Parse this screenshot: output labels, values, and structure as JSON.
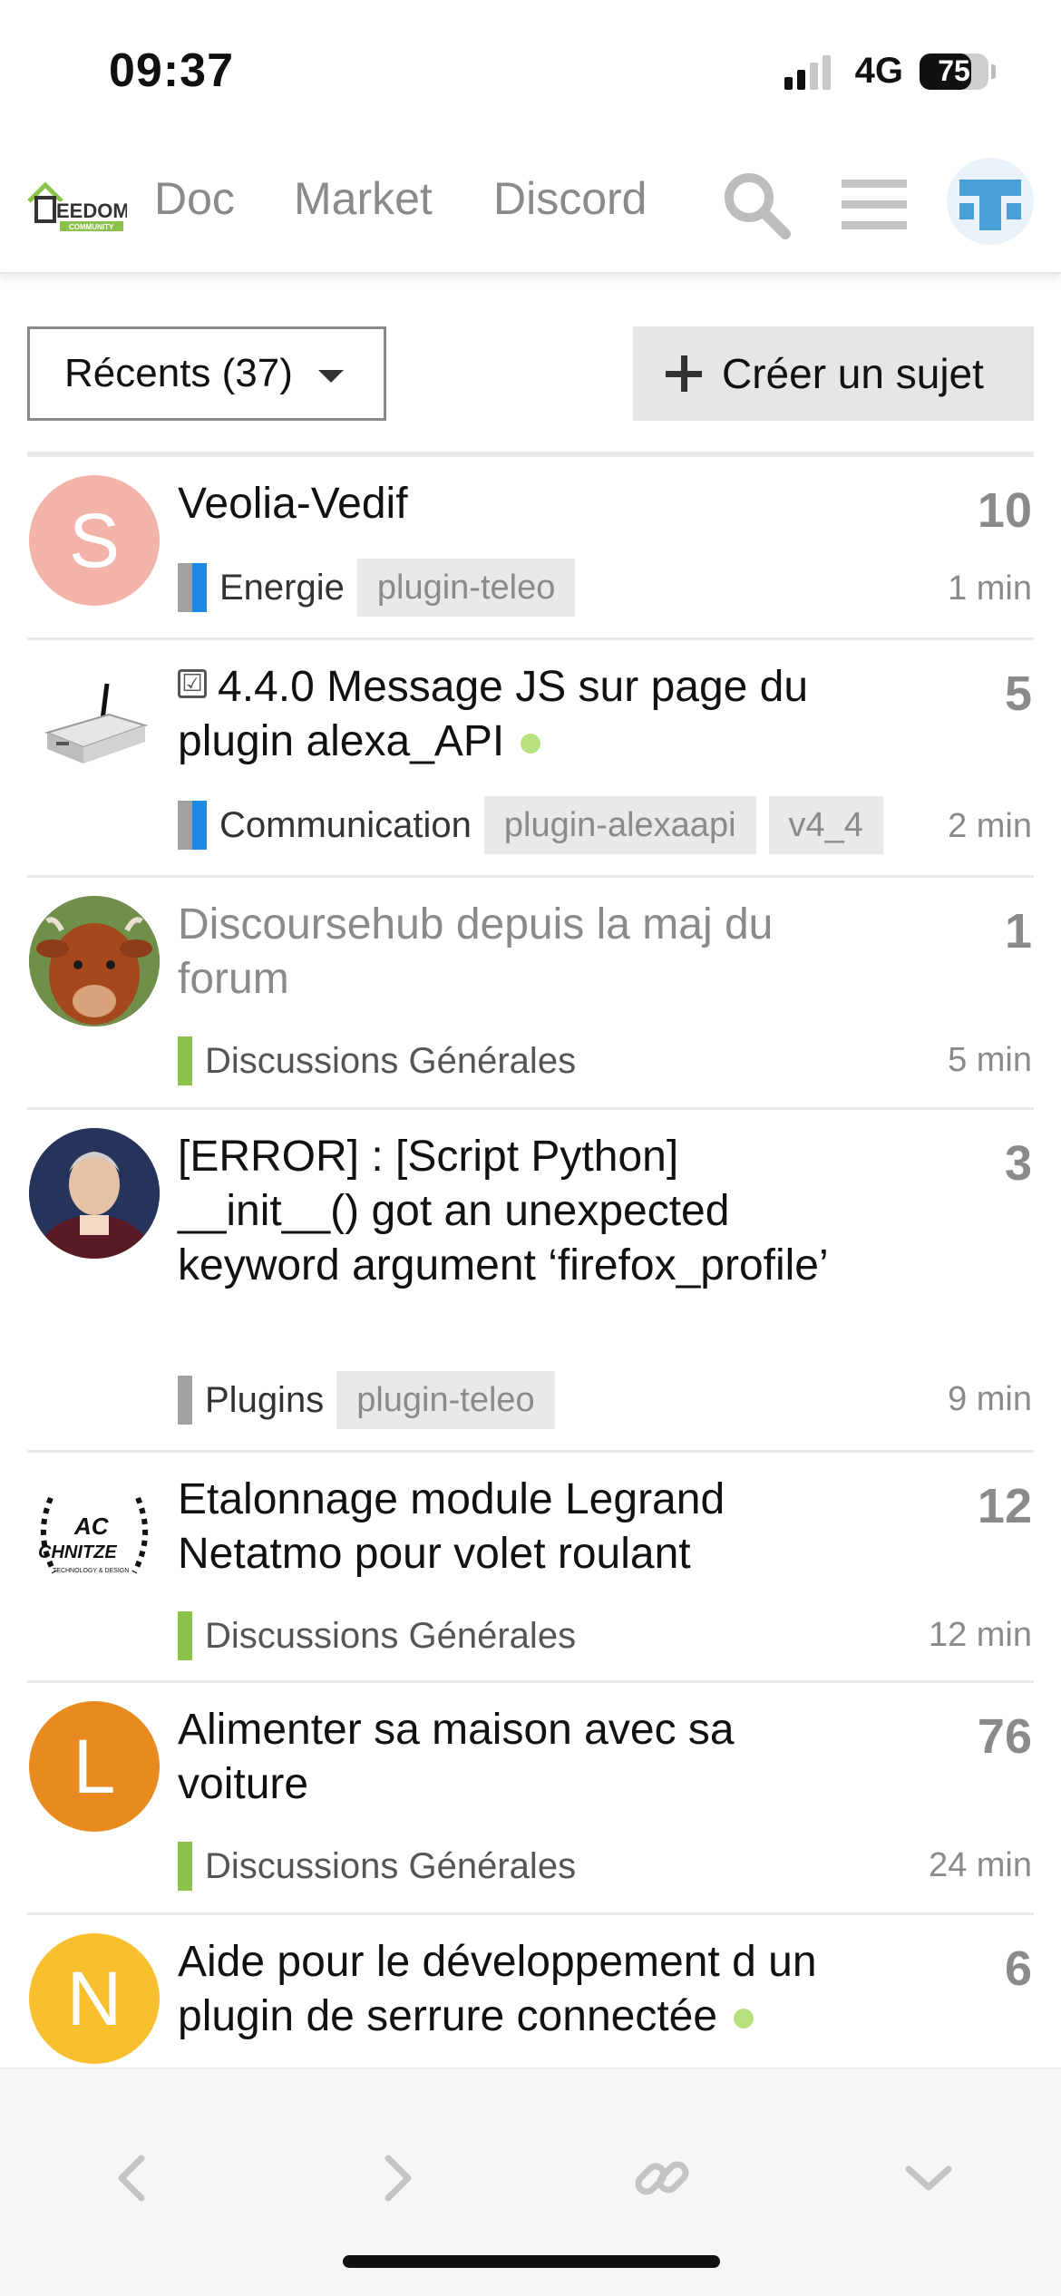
{
  "status_bar": {
    "time": "09:37",
    "network": "4G",
    "battery": "75",
    "battery_level": 0.75
  },
  "header": {
    "logo_name": "jeedom-community-logo",
    "logo_text": "EEDOM",
    "logo_subtext": "COMMUNITY",
    "nav": [
      {
        "label": "Doc"
      },
      {
        "label": "Market"
      },
      {
        "label": "Discord"
      }
    ],
    "icons": [
      "search-icon",
      "hamburger-menu-icon",
      "user-avatar"
    ]
  },
  "toolbar": {
    "filter_label": "Récents (37)",
    "create_label": "Créer un sujet"
  },
  "colors": {
    "accent_green": "#8bc34a",
    "energie_blue": "#1e88e5",
    "gray_text": "#8a8a8a",
    "new_dot": "#b7e27e",
    "avatar_s": "#f2b3aa",
    "avatar_l": "#e88a1f",
    "avatar_n": "#f8c02f"
  },
  "topics": [
    {
      "title": "Veolia-Vedif",
      "avatar_letter": "S",
      "category": "Energie",
      "tags": [
        "plugin-teleo"
      ],
      "replies": "10",
      "age": "1 min"
    },
    {
      "title": "4.4.0 Message JS sur page du plugin alexa_API",
      "solved_icon": "☑",
      "category": "Communication",
      "tags": [
        "plugin-alexaapi",
        "v4_4"
      ],
      "replies": "5",
      "age": "2 min"
    },
    {
      "title": "Discoursehub depuis la maj du forum",
      "category": "Discussions Générales",
      "tags": [],
      "replies": "1",
      "age": "5 min"
    },
    {
      "title": "[ERROR] : [Script Python] __init__() got an unexpected keyword argument ‘firefox_profile’",
      "category": "Plugins",
      "tags": [
        "plugin-teleo"
      ],
      "replies": "3",
      "age": "9 min"
    },
    {
      "title": "Etalonnage module Legrand Netatmo pour volet roulant",
      "avatar_text_top": "AC",
      "avatar_text_mid": "CHNITZE",
      "avatar_text_bottom": "TECHNOLOGY & DESIGN",
      "category": "Discussions Générales",
      "tags": [],
      "replies": "12",
      "age": "12 min"
    },
    {
      "title": "Alimenter sa maison avec sa voiture",
      "avatar_letter": "L",
      "category": "Discussions Générales",
      "tags": [],
      "replies": "76",
      "age": "24 min"
    },
    {
      "title": "Aide pour le développement d un plugin de serrure connectée",
      "avatar_letter": "N",
      "replies": "6"
    }
  ],
  "bottom_bar": {
    "icons": [
      "back-icon",
      "forward-icon",
      "link-icon",
      "collapse-icon"
    ]
  }
}
